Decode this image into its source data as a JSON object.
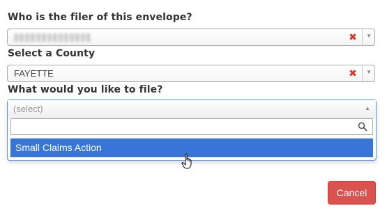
{
  "filer": {
    "label": "Who is the filer of this envelope?",
    "clear_icon": "✖",
    "arrow_icon": "▼"
  },
  "county": {
    "label": "Select a County",
    "value": "FAYETTE",
    "clear_icon": "✖",
    "arrow_icon": "▼"
  },
  "filing": {
    "label": "What would you like to file?",
    "placeholder": "(select)",
    "arrow_icon": "▲",
    "search_placeholder": "",
    "options": [
      "Small Claims Action"
    ]
  },
  "actions": {
    "cancel_label": "Cancel"
  },
  "colors": {
    "highlight": "#3875d7",
    "danger": "#d9534f",
    "clear_x": "#d9342b"
  },
  "icons": [
    "clear-icon",
    "chevron-down-icon",
    "chevron-up-icon",
    "search-icon",
    "hand-cursor-icon"
  ]
}
